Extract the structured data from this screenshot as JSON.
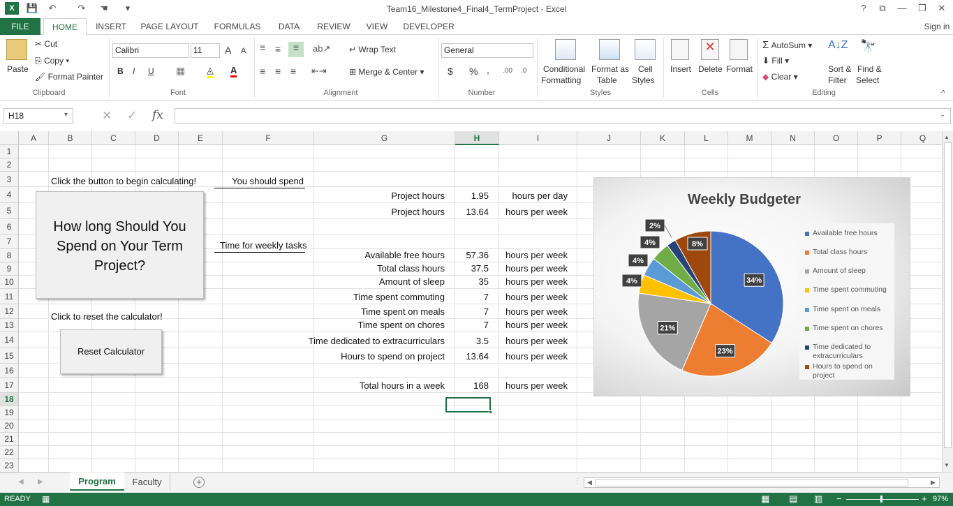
{
  "window": {
    "title": "Team16_Milestone4_Final4_TermProject - Excel",
    "controls": {
      "help": "?",
      "restore_ribbon": "⧉",
      "minimize": "—",
      "maximize": "❐",
      "close": "✕"
    }
  },
  "quick_access": {
    "excel_logo": "X",
    "save": "💾",
    "undo": "↶",
    "redo": "↷",
    "touch": "☚",
    "more": "▾"
  },
  "tabs": [
    "FILE",
    "HOME",
    "INSERT",
    "PAGE LAYOUT",
    "FORMULAS",
    "DATA",
    "REVIEW",
    "VIEW",
    "DEVELOPER"
  ],
  "sign_in": "Sign in",
  "ribbon": {
    "clipboard": {
      "paste": "Paste",
      "cut": "Cut",
      "copy": "Copy",
      "format_painter": "Format Painter",
      "label": "Clipboard"
    },
    "font": {
      "name": "Calibri",
      "size": "11",
      "bold": "B",
      "italic": "I",
      "underline": "U",
      "grow": "A",
      "shrink": "A",
      "label": "Font"
    },
    "alignment": {
      "wrap_text": "Wrap Text",
      "merge_center": "Merge & Center",
      "label": "Alignment"
    },
    "number": {
      "format": "General",
      "currency": "$",
      "percent": "%",
      "comma": ",",
      "label": "Number"
    },
    "styles": {
      "conditional": "Conditional",
      "conditional2": "Formatting",
      "format_as": "Format as",
      "format_as2": "Table",
      "cell": "Cell",
      "cell2": "Styles",
      "label": "Styles"
    },
    "cells": {
      "insert": "Insert",
      "delete": "Delete",
      "format": "Format",
      "label": "Cells"
    },
    "editing": {
      "autosum": "AutoSum",
      "fill": "Fill",
      "clear": "Clear",
      "sort": "Sort &",
      "sort2": "Filter",
      "find": "Find &",
      "find2": "Select",
      "label": "Editing"
    }
  },
  "formula_bar": {
    "name_box": "H18",
    "cancel": "✕",
    "enter": "✓",
    "fx": "fx",
    "content": ""
  },
  "columns": [
    "A",
    "B",
    "C",
    "D",
    "E",
    "F",
    "G",
    "H",
    "I",
    "J",
    "K",
    "L",
    "M",
    "N",
    "O",
    "P",
    "Q"
  ],
  "rows": [
    "1",
    "2",
    "3",
    "4",
    "5",
    "6",
    "7",
    "8",
    "9",
    "10",
    "11",
    "12",
    "13",
    "14",
    "15",
    "16",
    "17",
    "18",
    "19",
    "20",
    "21",
    "22",
    "23"
  ],
  "selected_cell": "H18",
  "sheet": {
    "b3": "Click the button to begin calculating!",
    "f3": "You should spend",
    "f7": "Time for weekly tasks",
    "b12": "Click to reset the calculator!",
    "calc_button": "How long Should You Spend on Your Term Project?",
    "reset_button": "Reset Calculator",
    "rows": [
      {
        "label": "Project hours",
        "value": "1.95",
        "unit": "hours per day"
      },
      {
        "label": "Project hours",
        "value": "13.64",
        "unit": "hours per week"
      },
      {
        "label": "Available free hours",
        "value": "57.36",
        "unit": "hours per week"
      },
      {
        "label": "Total class hours",
        "value": "37.5",
        "unit": "hours per week"
      },
      {
        "label": "Amount of sleep",
        "value": "35",
        "unit": "hours per week"
      },
      {
        "label": "Time spent commuting",
        "value": "7",
        "unit": "hours per week"
      },
      {
        "label": "Time spent on meals",
        "value": "7",
        "unit": "hours per week"
      },
      {
        "label": "Time spent on chores",
        "value": "7",
        "unit": "hours per week"
      },
      {
        "label": "Time dedicated to extracurriculars",
        "value": "3.5",
        "unit": "hours per week"
      },
      {
        "label": "Hours to spend on project",
        "value": "13.64",
        "unit": "hours per week"
      },
      {
        "label": "Total hours in a week",
        "value": "168",
        "unit": "hours per week"
      }
    ]
  },
  "chart_data": {
    "type": "pie",
    "title": "Weekly Budgeter",
    "categories": [
      "Available free hours",
      "Total class hours",
      "Amount of sleep",
      "Time spent commuting",
      "Time spent on meals",
      "Time spent on chores",
      "Time dedicated to extracurriculars",
      "Hours to spend on project"
    ],
    "values": [
      57.36,
      37.5,
      35,
      7,
      7,
      7,
      3.5,
      13.64
    ],
    "data_labels": [
      "34%",
      "23%",
      "21%",
      "4%",
      "4%",
      "4%",
      "2%",
      "8%"
    ],
    "colors": [
      "#4472C4",
      "#ED7D31",
      "#A5A5A5",
      "#FFC000",
      "#5B9BD5",
      "#70AD47",
      "#264478",
      "#9E480E"
    ],
    "legend_position": "right"
  },
  "sheet_tabs": [
    "Program",
    "Faculty"
  ],
  "active_sheet": "Program",
  "status": {
    "mode": "READY",
    "zoom": "97%"
  }
}
